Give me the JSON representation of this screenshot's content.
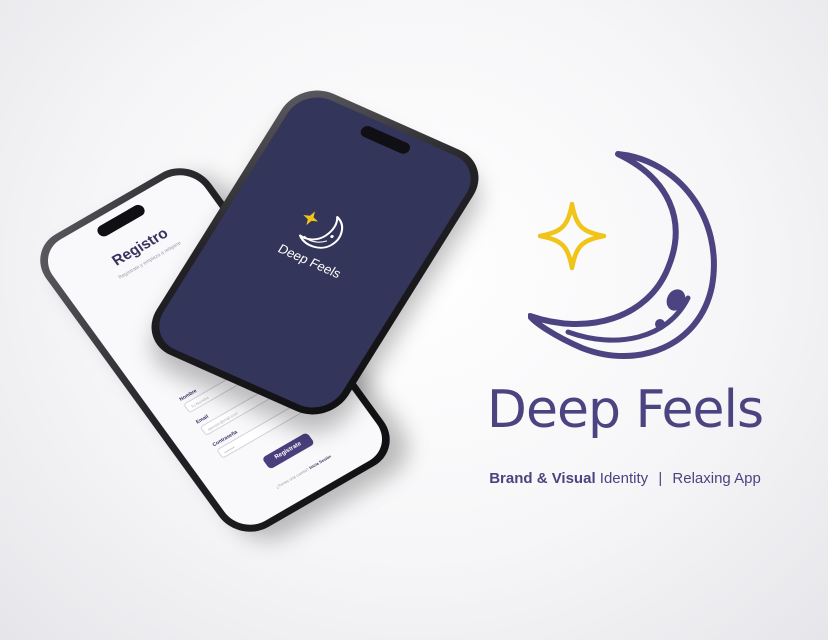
{
  "colors": {
    "brand_purple": "#4c4480",
    "star_yellow": "#f0c419",
    "splash_background": "#34355a",
    "illustration_magenta": "#b064c9"
  },
  "phone_registration": {
    "title": "Registro",
    "subtitle": "Regístrate y empieza a relajarte",
    "fields": [
      {
        "label": "Nombre",
        "placeholder": "Tu Nombre"
      },
      {
        "label": "Email",
        "placeholder": "ejemplo@mail.com"
      },
      {
        "label": "Contraseña",
        "placeholder": "••••••••"
      }
    ],
    "button_label": "Regístrate",
    "footer_question": "¿Tienes una cuenta?",
    "footer_link": "Inicia Sesión"
  },
  "phone_splash": {
    "app_name": "Deep Feels",
    "logo_icon": "moon-star-icon"
  },
  "brand": {
    "logo_icon": "moon-star-icon",
    "name": "Deep Feels",
    "tagline_bold": "Brand & Visual",
    "tagline_rest": "Identity",
    "separator": "|",
    "tagline_right": "Relaxing App"
  }
}
